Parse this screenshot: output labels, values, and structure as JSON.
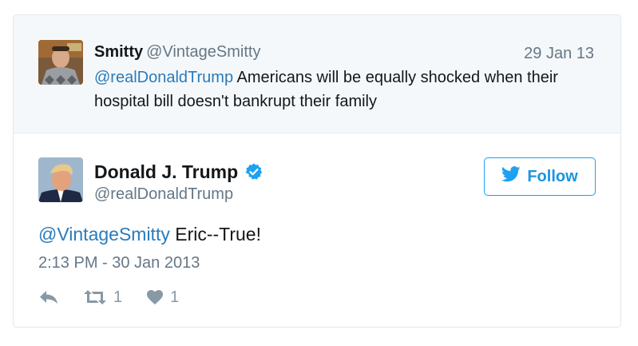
{
  "parent_tweet": {
    "author_name": "Smitty",
    "author_handle": "@VintageSmitty",
    "date": "29 Jan 13",
    "mention": "@realDonaldTrump",
    "text": " Americans will be equally shocked when their hospital bill doesn't bankrupt their family"
  },
  "main_tweet": {
    "author_name": "Donald J. Trump",
    "author_handle": "@realDonaldTrump",
    "verified_icon": "verified-badge-icon",
    "follow_label": "Follow",
    "mention": "@VintageSmitty",
    "text": " Eric--True!",
    "timestamp": "2:13 PM - 30 Jan 2013",
    "retweet_count": "1",
    "like_count": "1"
  },
  "colors": {
    "link": "#2b7bb9",
    "follow_accent": "#1da1f2",
    "verified": "#1da1f2",
    "muted": "#657786",
    "action_icon": "#8899a6",
    "parent_background": "#f5f8fa"
  },
  "icons": [
    "reply-icon",
    "retweet-icon",
    "heart-icon",
    "twitter-bird-icon",
    "verified-badge-icon"
  ]
}
